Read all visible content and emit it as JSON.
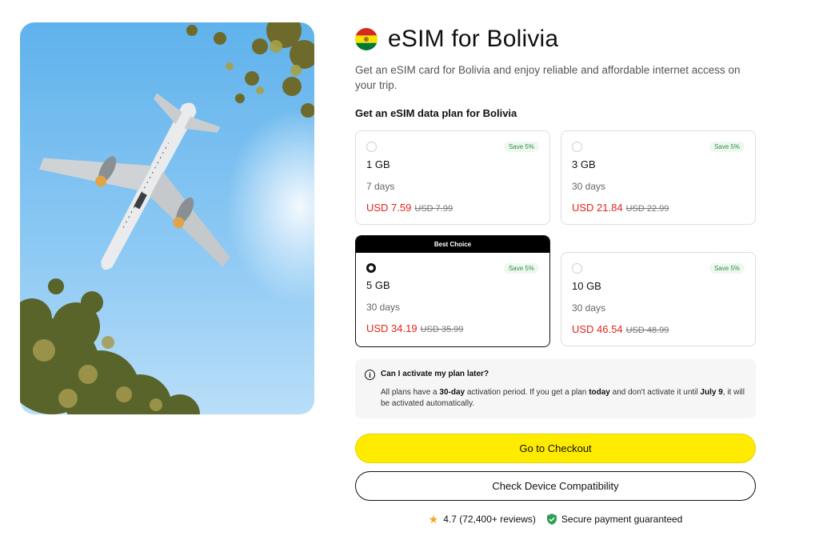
{
  "page": {
    "title": "eSIM for Bolivia",
    "description": "Get an eSIM card for Bolivia and enjoy reliable and affordable internet access on your trip.",
    "subheading": "Get an eSIM data plan for Bolivia"
  },
  "plans": [
    {
      "size": "1 GB",
      "days": "7 days",
      "price": "USD 7.59",
      "old_price": "USD 7.99",
      "save": "Save 5%",
      "selected": false
    },
    {
      "size": "3 GB",
      "days": "30 days",
      "price": "USD 21.84",
      "old_price": "USD 22.99",
      "save": "Save 5%",
      "selected": false
    },
    {
      "size": "5 GB",
      "days": "30 days",
      "price": "USD 34.19",
      "old_price": "USD 35.99",
      "save": "Save 5%",
      "selected": true,
      "banner": "Best Choice"
    },
    {
      "size": "10 GB",
      "days": "30 days",
      "price": "USD 46.54",
      "old_price": "USD 48.99",
      "save": "Save 5%",
      "selected": false
    }
  ],
  "faq": {
    "question": "Can I activate my plan later?",
    "answer_1": "All plans have a ",
    "answer_2": "30-day",
    "answer_3": " activation period. If you get a plan ",
    "answer_4": "today",
    "answer_5": " and don't activate it until ",
    "answer_6": "July 9",
    "answer_7": ", it will be activated automatically."
  },
  "buttons": {
    "checkout": "Go to Checkout",
    "compatibility": "Check Device Compatibility"
  },
  "footer": {
    "rating": "4.7 (72,400+ reviews)",
    "secure": "Secure payment guaranteed"
  },
  "icons": {
    "flag": "bolivia-flag-icon",
    "info": "info-icon",
    "star": "star-icon",
    "shield": "shield-check-icon"
  },
  "colors": {
    "accent_yellow": "#ffeb00",
    "price_red": "#e1251b",
    "save_green": "#2f8f46",
    "flag_red": "#d52b1e",
    "flag_yellow": "#f9e300",
    "flag_green": "#007934"
  }
}
